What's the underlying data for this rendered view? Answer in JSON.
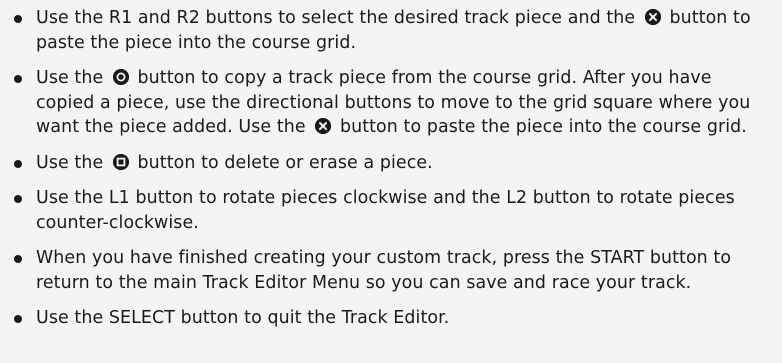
{
  "instructions": [
    {
      "parts": [
        "Use the R1 and R2 buttons to select the desired track piece and the",
        "button to paste the piece into the course grid."
      ],
      "icon": "cross-button-icon"
    },
    {
      "parts": [
        "Use the",
        "button to copy a track piece from the course grid.  After you have copied a piece, use the directional buttons to move to the grid square where you want the piece added.  Use the",
        "button to paste the piece into the course grid."
      ],
      "icons": [
        "circle-button-icon",
        "cross-button-icon"
      ]
    },
    {
      "parts": [
        "Use the",
        "button to delete or erase a piece."
      ],
      "icon": "square-button-icon"
    },
    {
      "text": "Use the L1 button to rotate pieces clockwise and the L2 button to rotate pieces counter-clockwise."
    },
    {
      "text": "When you have finished creating your custom track, press the START button to return to the main Track Editor Menu so you can save and race your track."
    },
    {
      "text": "Use the SELECT button to quit the Track Editor."
    }
  ]
}
